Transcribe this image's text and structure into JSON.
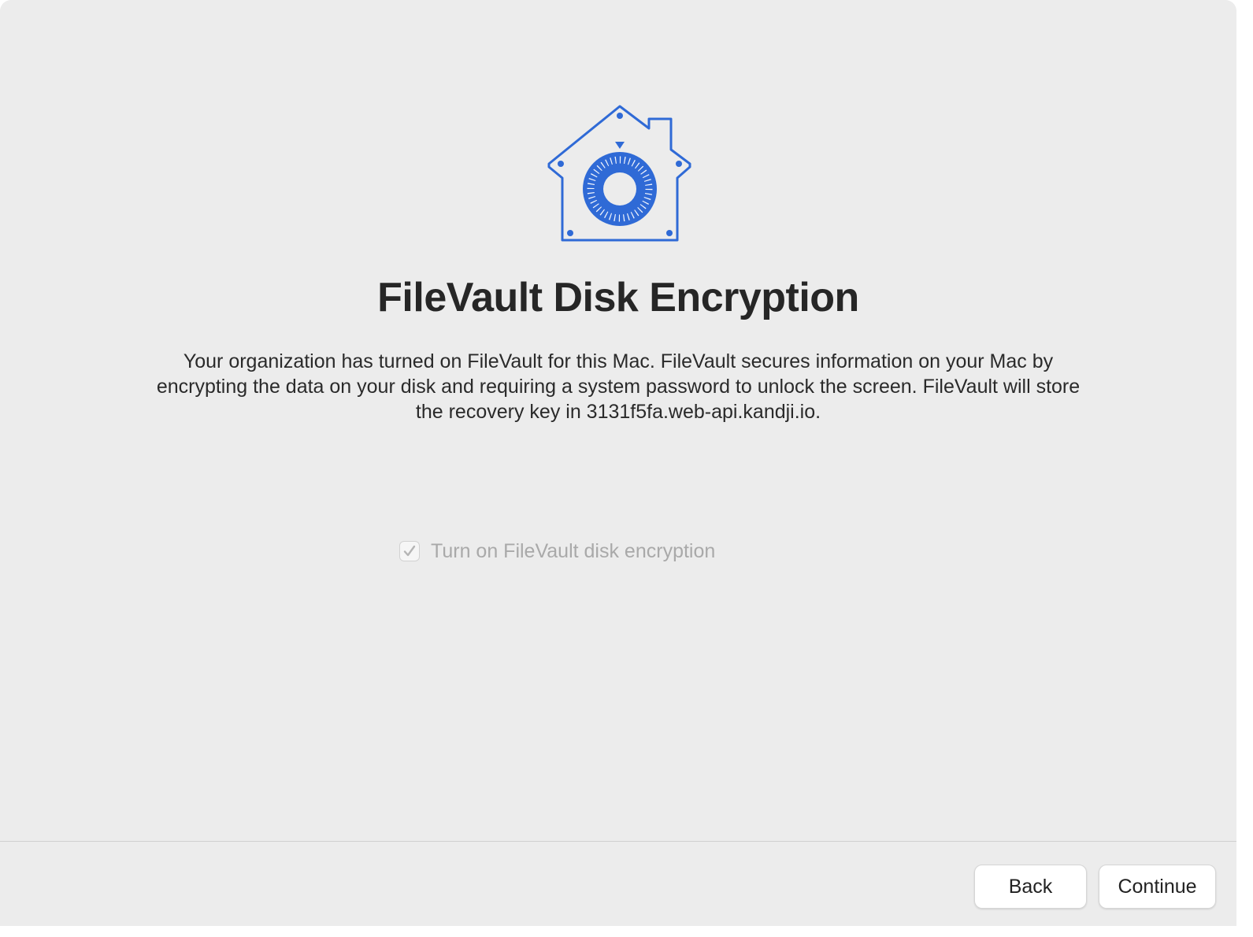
{
  "window": {
    "title": "FileVault Disk Encryption",
    "description": "Your organization has turned on FileVault for this Mac. FileVault secures information on your Mac by encrypting the data on your disk and requiring a system password to unlock the screen. FileVault will store the recovery key in 3131f5fa.web-api.kandji.io.",
    "icon": "filevault-house-icon"
  },
  "checkbox": {
    "label": "Turn on FileVault disk encryption",
    "checked": true,
    "disabled": true
  },
  "buttons": {
    "back_label": "Back",
    "continue_label": "Continue"
  },
  "colors": {
    "accent": "#2f6ad6",
    "background": "#ececec",
    "title_text": "#262626",
    "disabled_text": "#a9a9a9"
  }
}
